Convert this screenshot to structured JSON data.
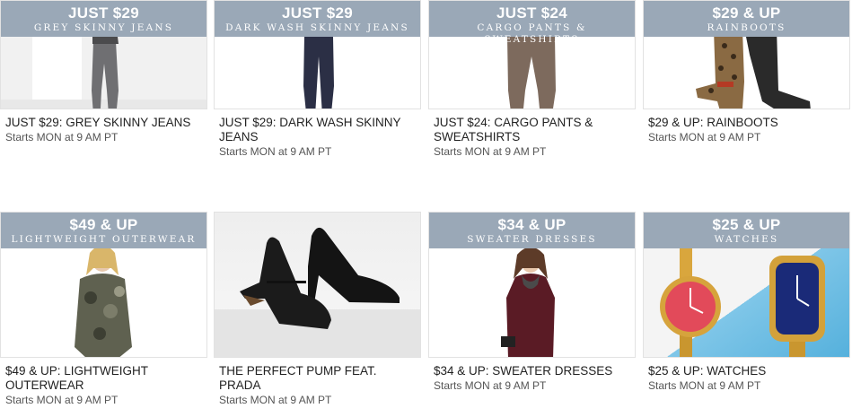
{
  "cards": [
    {
      "banner_price": "JUST $29",
      "banner_sub": "GREY SKINNY JEANS",
      "title": "JUST $29: GREY SKINNY JEANS",
      "starts": "Starts MON at 9 AM PT",
      "image": "grey-jeans-photo"
    },
    {
      "banner_price": "JUST $29",
      "banner_sub": "DARK WASH SKINNY JEANS",
      "title": "JUST $29: DARK WASH SKINNY JEANS",
      "starts": "Starts MON at 9 AM PT",
      "image": "dark-jeans-photo"
    },
    {
      "banner_price": "JUST $24",
      "banner_sub": "CARGO PANTS & SWEATSHIRTS",
      "title": "JUST $24: CARGO PANTS & SWEATSHIRTS",
      "starts": "Starts MON at 9 AM PT",
      "image": "cargo-pants-photo"
    },
    {
      "banner_price": "$29 & UP",
      "banner_sub": "RAINBOOTS",
      "title": "$29 & UP: RAINBOOTS",
      "starts": "Starts MON at 9 AM PT",
      "image": "rainboots-photo"
    },
    {
      "banner_price": "$49 & UP",
      "banner_sub": "LIGHTWEIGHT OUTERWEAR",
      "title": "$49 & UP: LIGHTWEIGHT OUTERWEAR",
      "starts": "Starts MON at 9 AM PT",
      "image": "outerwear-photo"
    },
    {
      "banner_price": "",
      "banner_sub": "",
      "title": "THE PERFECT PUMP FEAT. PRADA",
      "starts": "Starts MON at 9 AM PT",
      "image": "pumps-photo"
    },
    {
      "banner_price": "$34 & UP",
      "banner_sub": "SWEATER DRESSES",
      "title": "$34 & UP: SWEATER DRESSES",
      "starts": "Starts MON at 9 AM PT",
      "image": "sweater-dress-photo"
    },
    {
      "banner_price": "$25 & UP",
      "banner_sub": "WATCHES",
      "title": "$25 & UP: WATCHES",
      "starts": "Starts MON at 9 AM PT",
      "image": "watches-photo"
    }
  ],
  "colors": {
    "banner": "#9aa8b7",
    "text": "#222222",
    "subtext": "#555555"
  }
}
